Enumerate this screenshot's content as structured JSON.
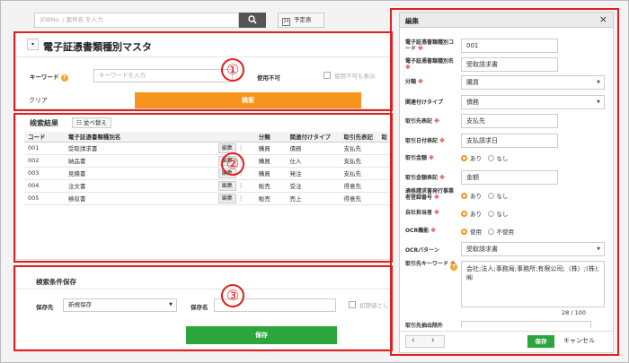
{
  "topbar": {
    "search_placeholder": "JOBNo. / 案件名 を入力",
    "schedule_label": "予定表",
    "cal_day": "29"
  },
  "master": {
    "title": "電子証憑書類種別マスタ",
    "keyword_label": "キーワード",
    "keyword_placeholder": "キーワードを入力",
    "unusable_label": "使用不可",
    "include_unusable_label": "使用不可も表示",
    "clear_label": "クリア",
    "search_label": "検索"
  },
  "results": {
    "title": "検索結果",
    "sort_label": "並べ替え",
    "edit_label": "編集",
    "columns": [
      "コード",
      "電子証憑書類種別名",
      "",
      "分類",
      "関連付けタイプ",
      "取引先表記",
      "取"
    ],
    "rows": [
      {
        "code": "001",
        "name": "受取請求書",
        "cls": "購買",
        "type": "債務",
        "partner": "支払先"
      },
      {
        "code": "002",
        "name": "納品書",
        "cls": "購買",
        "type": "仕入",
        "partner": "支払先"
      },
      {
        "code": "003",
        "name": "見積書",
        "cls": "購買",
        "type": "発注",
        "partner": "支払先"
      },
      {
        "code": "004",
        "name": "注文書",
        "cls": "販売",
        "type": "受注",
        "partner": "得意先"
      },
      {
        "code": "005",
        "name": "検収書",
        "cls": "販売",
        "type": "売上",
        "partner": "得意先"
      }
    ]
  },
  "save_cond": {
    "title": "検索条件保存",
    "dest_label": "保存先",
    "dest_value": "新規保存",
    "name_label": "保存名",
    "initial_label": "初期値とし",
    "save_label": "保存"
  },
  "edit": {
    "title": "編集",
    "close": "×",
    "fields": {
      "code_label": "電子証憑書類種別コード",
      "code_value": "001",
      "name_label": "電子証憑書類種別名",
      "name_value": "受取請求書",
      "class_label": "分類",
      "class_value": "購買",
      "link_label": "関連付けタイプ",
      "link_value": "債務",
      "partner_label": "取引先表記",
      "partner_value": "支払先",
      "date_label": "取引日付表記",
      "date_value": "支払請求日",
      "amount_label": "取引金額",
      "amount_on": "あり",
      "amount_off": "なし",
      "amount_notation_label": "取引金額表記",
      "amount_notation_value": "金額",
      "invoice_label": "適格請求書発行事業者登録番号",
      "invoice_on": "あり",
      "invoice_off": "なし",
      "owner_label": "自社担当者",
      "owner_on": "あり",
      "owner_off": "なし",
      "ocr_label": "OCR機能",
      "ocr_on": "使用",
      "ocr_off": "不使用",
      "pattern_label": "OCRパターン",
      "pattern_value": "受取請求書",
      "keyword_label": "取引先キーワード",
      "keyword_value": "会社;法人;事務局;事務所;有限公司;（株）;(株);㈱",
      "keyword_count": "28 / 100",
      "exclude_label": "取引先抽出除外"
    },
    "save_label": "保存",
    "cancel_label": "キャンセル",
    "prev": "‹",
    "next": "›"
  },
  "markers": [
    "①",
    "②",
    "③"
  ]
}
